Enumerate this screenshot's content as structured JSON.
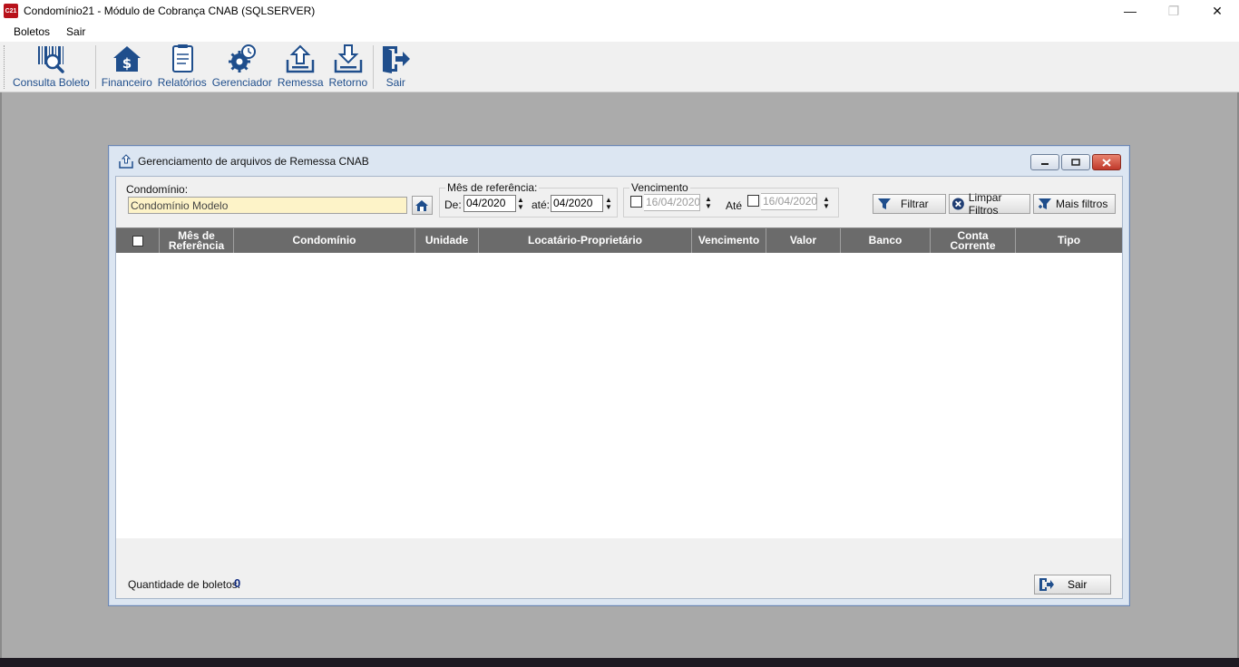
{
  "window": {
    "title": "Condomínio21 - Módulo de Cobrança CNAB (SQLSERVER)",
    "app_icon_text": "C21",
    "minimize": "—",
    "restore": "❐",
    "close": "✕"
  },
  "menu": {
    "items": [
      "Boletos",
      "Sair"
    ]
  },
  "toolbar": {
    "consulta_boleto": "Consulta Boleto",
    "financeiro": "Financeiro",
    "relatorios": "Relatórios",
    "gerenciador": "Gerenciador",
    "remessa": "Remessa",
    "retorno": "Retorno",
    "sair": "Sair"
  },
  "child": {
    "title": "Gerenciamento de arquivos de Remessa CNAB",
    "condominio_label": "Condomínio:",
    "condominio_value": "Condomínio Modelo",
    "mes_ref_legend": "Mês de referência:",
    "de_label": "De:",
    "de_value": "04/2020",
    "ate_label": "até:",
    "ate_value": "04/2020",
    "venc_legend": "Vencimento",
    "venc_de_value": "16/04/2020",
    "venc_ate_label": "Até",
    "venc_ate_value": "16/04/2020",
    "filtrar": "Filtrar",
    "limpar_filtros": "Limpar Filtros",
    "mais_filtros": "Mais filtros",
    "columns": [
      "Mês de Referência",
      "Condomínio",
      "Unidade",
      "Locatário-Proprietário",
      "Vencimento",
      "Valor",
      "Banco",
      "Conta Corrente",
      "Tipo"
    ],
    "qty_label": "Quantidade de boletos:",
    "qty_value": "0",
    "sair": "Sair"
  },
  "colors": {
    "accent": "#1f4e8c",
    "grid_header": "#6b6b6b",
    "workspace": "#ababab"
  }
}
